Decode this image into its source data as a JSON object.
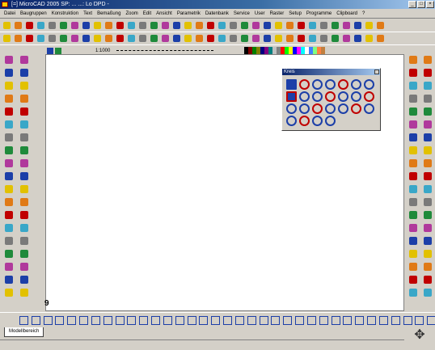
{
  "window": {
    "title": "[=] MicroCAD 2005 SP: ...  ...: Lo DPD -"
  },
  "menu": {
    "items": [
      "Datei",
      "Baugruppen",
      "Konstruktion",
      "Text",
      "Bemaßung",
      "Zoom",
      "Edit",
      "Ansicht",
      "Parametrik",
      "Datenbank",
      "Service",
      "User",
      "Raster",
      "Setup",
      "Programme",
      "Clipboard",
      "?"
    ]
  },
  "toolbar": {
    "row1_icons": [
      "open-file-icon",
      "save-icon",
      "folder-icon",
      "print-icon",
      "copy-icon",
      "grid-icon",
      "globe-icon",
      "edit-icon",
      "tools-icon",
      "layer-icon",
      "block-icon",
      "move-icon",
      "rotate-icon",
      "scale-icon",
      "mirror-icon",
      "trim-icon",
      "extend-icon",
      "fillet-icon",
      "hatch-icon",
      "measure-icon",
      "undo-icon",
      "redo-icon",
      "cube-icon",
      "cube-icon",
      "cube-icon",
      "cube-icon",
      "cube-icon",
      "cube-icon",
      "cube-icon",
      "window-icon",
      "window-icon",
      "window-icon",
      "cylinder-icon",
      "cylinder-icon"
    ],
    "row2_icons": [
      "zoom-in-icon",
      "zoom-out-icon",
      "zoom-window-icon",
      "zoom-all-icon",
      "zoom-prev-icon",
      "zoom-pan-icon",
      "zoom-extent-icon",
      "zoom-real-icon",
      "zoom-dynamic-icon",
      "zoom-scale-icon",
      "redraw-icon",
      "regen-icon",
      "view-front-icon",
      "view-top-icon",
      "view-side-icon",
      "view-iso-icon",
      "layer-on-icon",
      "layer-off-icon",
      "snap-icon",
      "grid-snap-icon",
      "ortho-icon",
      "polar-icon",
      "osnap-icon",
      "tracking-icon",
      "dimension-icon",
      "text-style-icon",
      "color-icon",
      "linetype-icon",
      "lineweight-icon",
      "properties-icon",
      "match-icon",
      "group-icon",
      "explode-icon",
      "purge-icon"
    ]
  },
  "statusline": {
    "scale_text": "1:1000",
    "colors": [
      "#000000",
      "#800000",
      "#008000",
      "#808000",
      "#000080",
      "#800080",
      "#008080",
      "#c0c0c0",
      "#808080",
      "#ff0000",
      "#00ff00",
      "#ffff00",
      "#0000ff",
      "#ff00ff",
      "#00ffff",
      "#ffffff",
      "#4080ff",
      "#80ff80",
      "#ff8040",
      "#c08040"
    ]
  },
  "palette": {
    "title": "Kreis",
    "rows": 4,
    "icons": [
      "circle-center-icon",
      "circle-2p-icon",
      "circle-3p-icon",
      "circle-tangent-icon",
      "circle-radius-icon",
      "circle-diameter-icon",
      "circle-concentric-icon",
      "arc-center-icon",
      "arc-3p-icon",
      "arc-tangent-icon",
      "arc-start-end-icon",
      "ellipse-icon",
      "ellipse-axis-icon",
      "ring-icon",
      "circle-grid-icon",
      "circle-offset-icon",
      "circle-mirror-icon",
      "circle-array-icon",
      "polygon-icon",
      "triangle-icon",
      "sphere-icon",
      "circle-fill-icon",
      "circle-half-icon",
      "circle-target-icon",
      "circle-angle-icon"
    ]
  },
  "left_toolbar_a": {
    "icons": [
      "element-icon",
      "edit-icon",
      "brush-icon",
      "mirror-icon",
      "cross-icon",
      "layers-icon",
      "plot-icon",
      "wrench-icon",
      "calculator-icon",
      "text-icon",
      "measure-icon",
      "erase-icon",
      "text-format-icon",
      "text-box-icon",
      "color-icon",
      "palette-icon",
      "tab-icon",
      "tab-icon",
      "column-icon",
      "column-icon",
      "cut-icon",
      "cut-icon",
      "pen-icon",
      "pen-icon",
      "chart-icon",
      "abc-icon"
    ]
  },
  "left_toolbar_b": {
    "icons": [
      "plus-icon",
      "line-icon",
      "circle-icon",
      "arc-icon",
      "polyline-icon",
      "spline-icon",
      "hatch-icon",
      "fillet-icon",
      "chamfer-icon",
      "grid-icon",
      "scissors-icon",
      "offset-icon",
      "table-icon",
      "rectangle-icon",
      "profile-icon",
      "block-icon",
      "shaft-icon",
      "user-icon",
      "cursor-icon",
      "star-icon",
      "gear-icon",
      "hole-icon",
      "thread-icon",
      "weld-icon",
      "symbol-icon",
      "border-icon",
      "dim-icon",
      "note-icon",
      "cursor-icon"
    ]
  },
  "right_toolbar_a": {
    "icons": [
      "pipe-icon",
      "flange-icon",
      "valve-icon",
      "elbow-icon",
      "tee-icon",
      "reducer-icon",
      "cap-icon",
      "bolt-icon",
      "nut-icon",
      "washer-icon",
      "screw-icon",
      "pin-icon",
      "spring-icon",
      "bearing-icon",
      "seal-icon",
      "key-icon",
      "gear-icon",
      "pulley-icon",
      "chain-icon",
      "belt-icon",
      "motor-icon",
      "pump-icon",
      "fan-icon",
      "arrow-icon"
    ]
  },
  "right_toolbar_b": {
    "icons": [
      "library-icon",
      "symbol-icon",
      "component-icon",
      "part-icon",
      "assembly-icon",
      "catalog-icon",
      "norm-icon",
      "din-icon",
      "iso-icon",
      "ansi-icon",
      "profile-icon",
      "beam-icon",
      "angle-icon",
      "channel-icon",
      "tube-icon",
      "plate-icon",
      "sheet-icon",
      "cylinder-icon",
      "cone-icon",
      "sphere-icon",
      "torus-icon",
      "wedge-icon",
      "pyramid-icon",
      "cursor-icon"
    ]
  },
  "bottom_toolbar": {
    "icons": [
      "select-icon",
      "chain-select-icon",
      "window-select-icon",
      "cross-select-icon",
      "fence-icon",
      "line-icon",
      "polyline-icon",
      "arc-icon",
      "circle-icon",
      "rectangle-icon",
      "polygon-icon",
      "text-icon",
      "dimension-icon",
      "hatch-icon",
      "block-icon",
      "insert-icon",
      "copy-icon",
      "move-icon",
      "rotate-icon",
      "scale-icon",
      "mirror-icon",
      "trim-icon",
      "extend-icon",
      "break-icon",
      "fillet-icon",
      "chamfer-icon",
      "stretch-icon",
      "explode-icon",
      "join-icon",
      "offset-icon",
      "array-icon",
      "measure-icon",
      "area-icon",
      "distance-icon",
      "angle-icon",
      "snap-end-icon",
      "snap-mid-icon",
      "snap-center-icon",
      "snap-quad-icon",
      "snap-perp-icon",
      "snap-tan-icon",
      "snap-near-icon"
    ]
  },
  "tabs": {
    "model_label": "Modellbereich"
  },
  "canvas": {
    "cursor_label": "9"
  }
}
